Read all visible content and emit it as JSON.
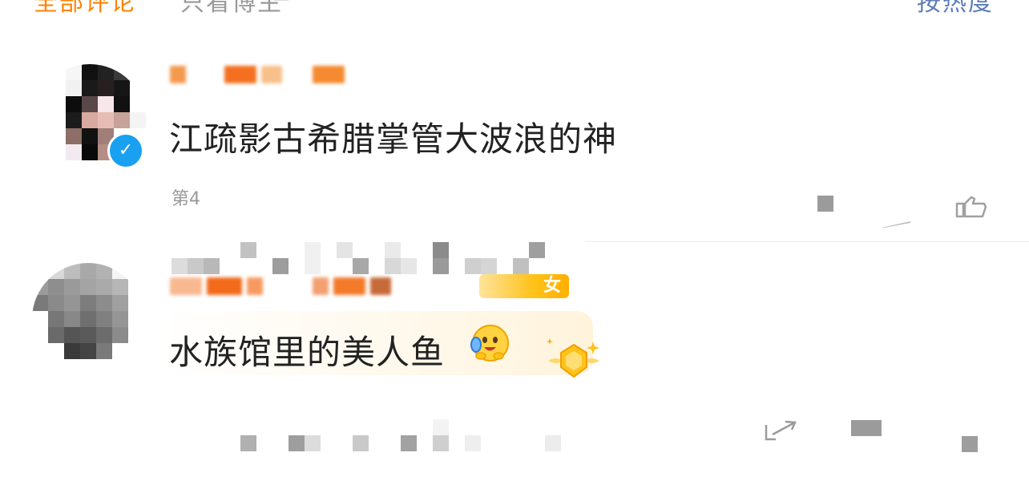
{
  "filter_bar": {
    "tab_all": "全部评论",
    "tab_other": "只看博主",
    "sort_label": "按热度"
  },
  "comments": [
    {
      "text": "江疏影古希腊掌管大波浪的神",
      "meta": "第4"
    },
    {
      "text": "水族馆里的美人鱼",
      "level_badge": "女"
    }
  ],
  "colors": {
    "accent": "#ff8200",
    "verified_blue": "#19a0f0",
    "badge_gold": "#ffc21a",
    "text_main": "#222222",
    "text_meta": "#999999"
  },
  "icons": {
    "verified": "verified-badge-icon",
    "emoji": "hug-emoji-icon",
    "rank": "gold-rank-badge-icon",
    "share": "share-icon",
    "comment": "comment-icon",
    "like": "like-icon"
  }
}
